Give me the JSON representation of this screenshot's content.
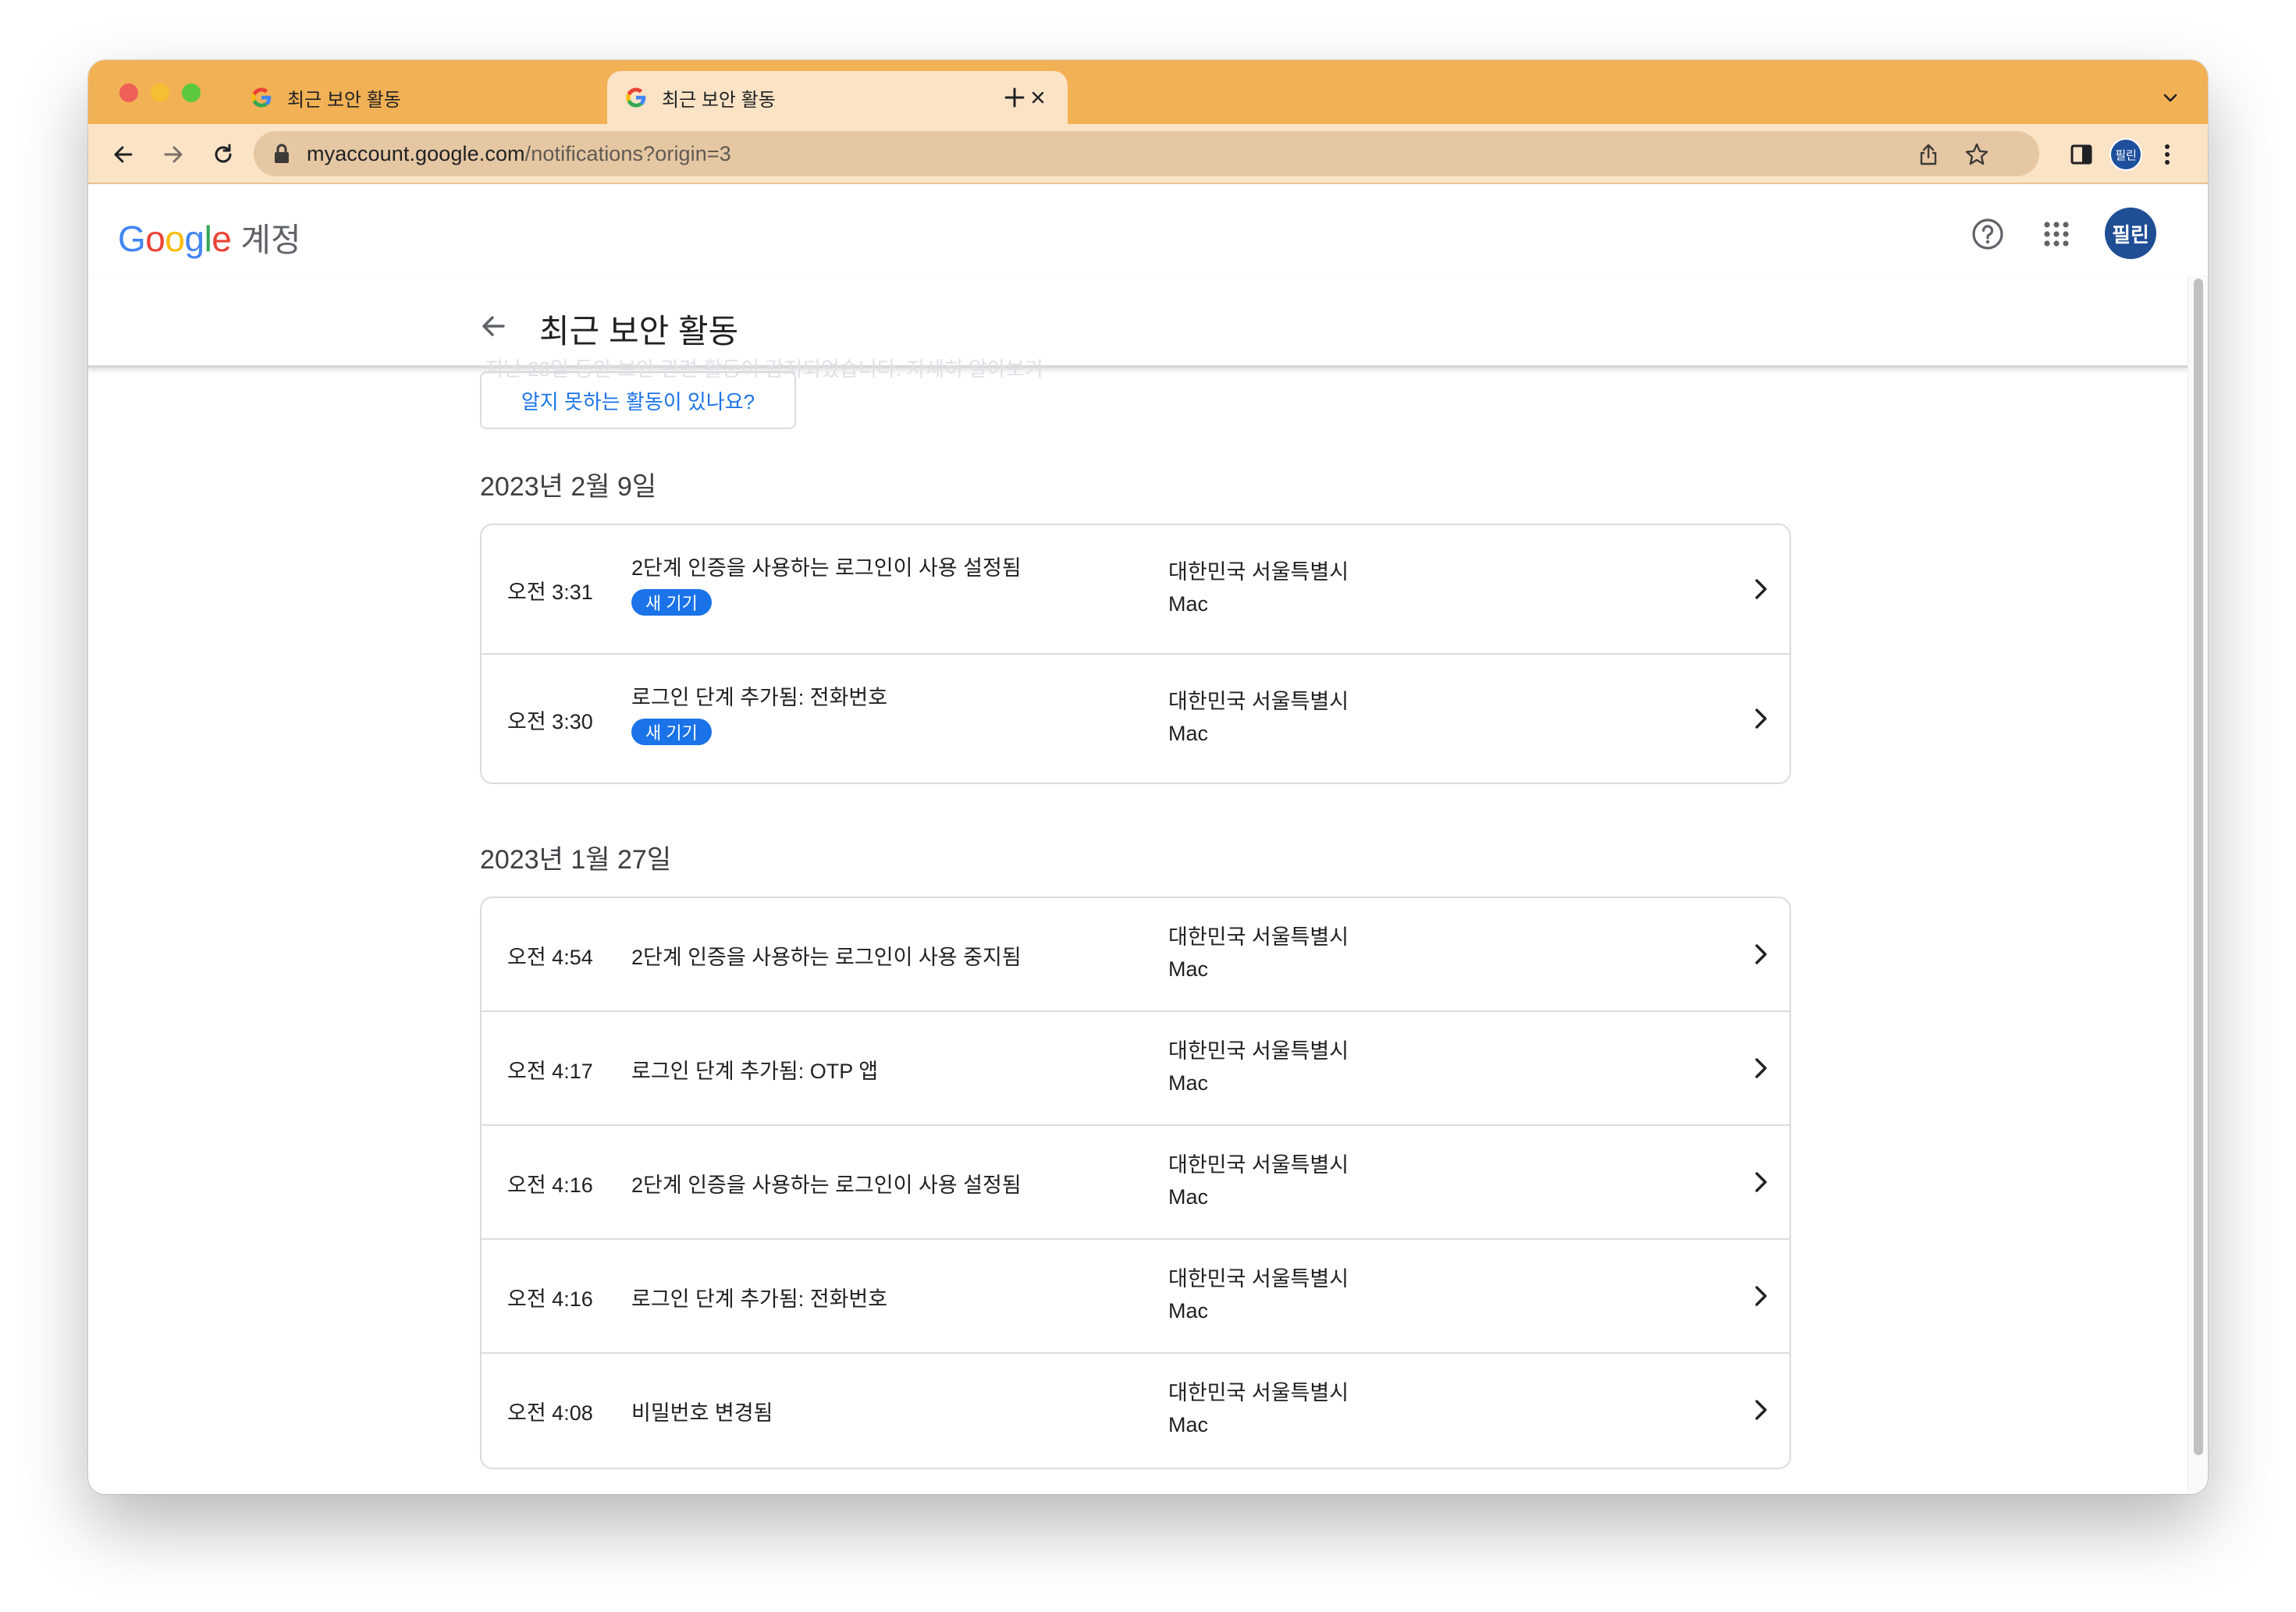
{
  "browser": {
    "tabs": [
      {
        "title": "최근 보안 활동",
        "active": false
      },
      {
        "title": "최근 보안 활동",
        "active": true
      }
    ],
    "url_host": "myaccount.google.com",
    "url_path": "/notifications?origin=3",
    "profile_initials": "필린",
    "colors": {
      "tabstrip": "#f2b155",
      "toolbar": "#fbe3c6"
    }
  },
  "header": {
    "logo_text": "Google",
    "account_label": "계정",
    "avatar_initials": "필린"
  },
  "page": {
    "title": "최근 보안 활동",
    "ghost_text": "지난 28일 동안 보안 관련 활동이 감지되었습니다. 자세히 알아보기",
    "question_button": "알지 못하는 활동이 있나요?"
  },
  "groups": [
    {
      "date": "2023년 2월 9일",
      "items": [
        {
          "time": "오전 3:31",
          "event": "2단계 인증을 사용하는 로그인이 사용 설정됨",
          "badge": "새 기기",
          "location": "대한민국 서울특별시",
          "device": "Mac"
        },
        {
          "time": "오전 3:30",
          "event": "로그인 단계 추가됨: 전화번호",
          "badge": "새 기기",
          "location": "대한민국 서울특별시",
          "device": "Mac"
        }
      ]
    },
    {
      "date": "2023년 1월 27일",
      "items": [
        {
          "time": "오전 4:54",
          "event": "2단계 인증을 사용하는 로그인이 사용 중지됨",
          "badge": "",
          "location": "대한민국 서울특별시",
          "device": "Mac"
        },
        {
          "time": "오전 4:17",
          "event": "로그인 단계 추가됨: OTP 앱",
          "badge": "",
          "location": "대한민국 서울특별시",
          "device": "Mac"
        },
        {
          "time": "오전 4:16",
          "event": "2단계 인증을 사용하는 로그인이 사용 설정됨",
          "badge": "",
          "location": "대한민국 서울특별시",
          "device": "Mac"
        },
        {
          "time": "오전 4:16",
          "event": "로그인 단계 추가됨: 전화번호",
          "badge": "",
          "location": "대한민국 서울특별시",
          "device": "Mac"
        },
        {
          "time": "오전 4:08",
          "event": "비밀번호 변경됨",
          "badge": "",
          "location": "대한민국 서울특별시",
          "device": "Mac"
        }
      ]
    }
  ]
}
